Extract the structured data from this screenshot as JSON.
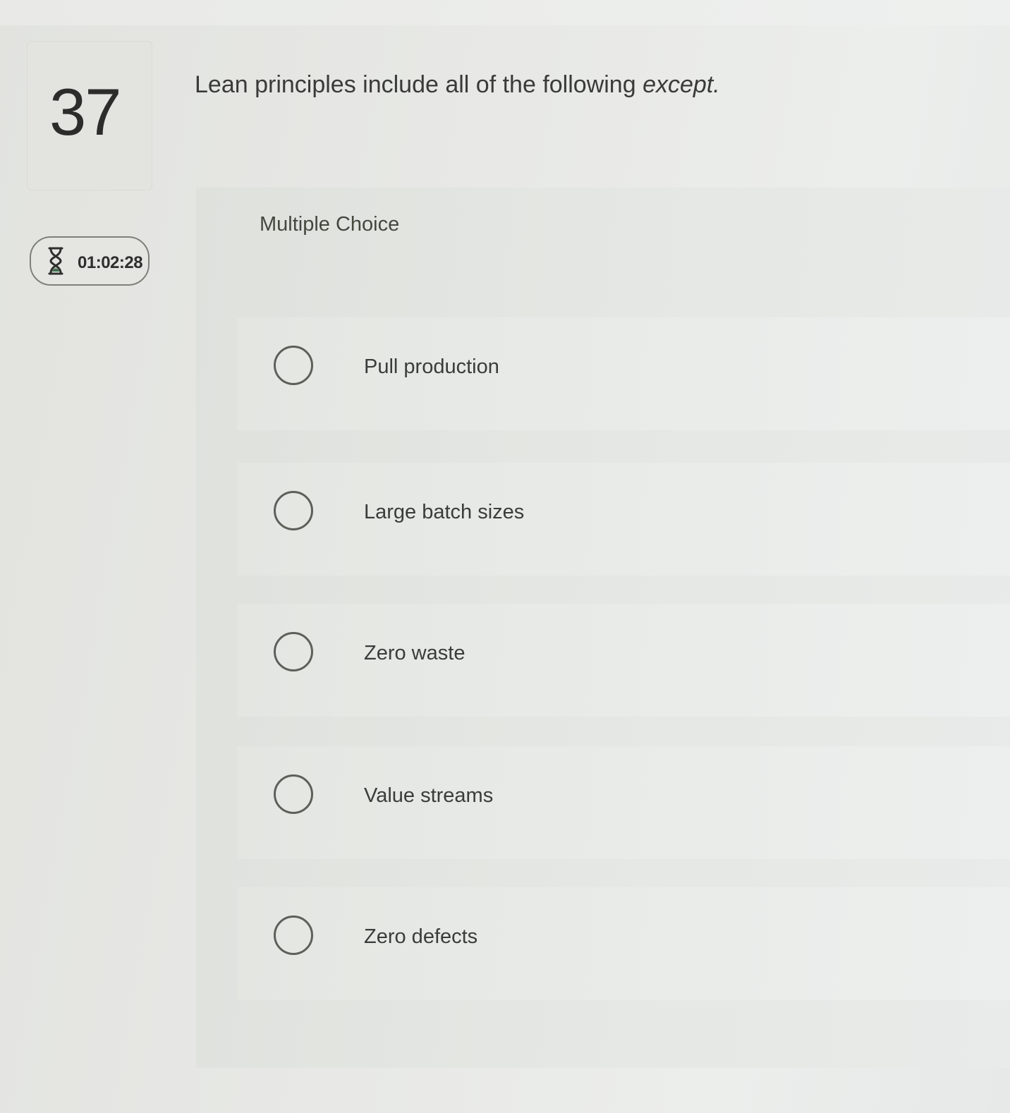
{
  "question": {
    "number": "37",
    "text": "Lean principles include all of the following ",
    "emphasis": "except."
  },
  "timer": {
    "icon": "hourglass-icon",
    "time": "01:02:28"
  },
  "choices": {
    "type_label": "Multiple Choice",
    "options": [
      {
        "label": "Pull production"
      },
      {
        "label": "Large batch sizes"
      },
      {
        "label": "Zero waste"
      },
      {
        "label": "Value streams"
      },
      {
        "label": "Zero defects"
      }
    ]
  },
  "colors": {
    "background": "#e6e7e4",
    "panel": "#e4e6e2",
    "text": "#2f302d",
    "radio_border": "#5d6059"
  }
}
